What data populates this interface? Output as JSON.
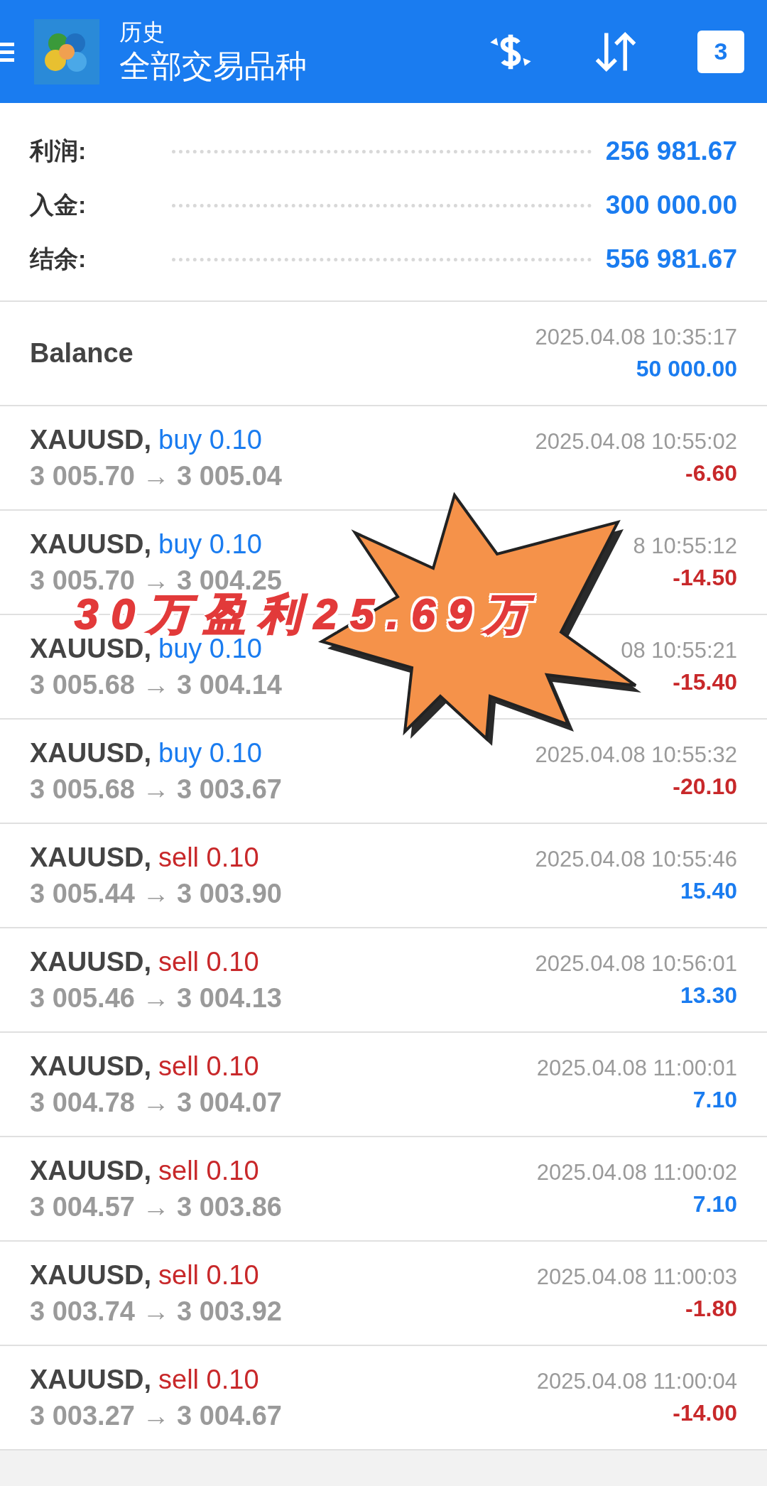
{
  "header": {
    "subtitle": "历史",
    "title": "全部交易品种",
    "calendar_day": "3"
  },
  "summary": [
    {
      "label": "利润:",
      "value": "256 981.67"
    },
    {
      "label": "入金:",
      "value": "300 000.00"
    },
    {
      "label": "结余:",
      "value": "556 981.67"
    }
  ],
  "balance": {
    "label": "Balance",
    "time": "2025.04.08 10:35:17",
    "amount": "50 000.00"
  },
  "trades": [
    {
      "symbol": "XAUUSD,",
      "kind": "buy",
      "side": "buy 0.10",
      "prices": "3 005.70 → 3 005.04",
      "time": "2025.04.08 10:55:02",
      "profit": "-6.60",
      "loss": true
    },
    {
      "symbol": "XAUUSD,",
      "kind": "buy",
      "side": "buy 0.10",
      "prices": "3 005.70 → 3 004.25",
      "time": "8 10:55:12",
      "profit": "-14.50",
      "loss": true
    },
    {
      "symbol": "XAUUSD,",
      "kind": "buy",
      "side": "buy 0.10",
      "prices": "3 005.68 → 3 004.14",
      "time": "08 10:55:21",
      "profit": "-15.40",
      "loss": true
    },
    {
      "symbol": "XAUUSD,",
      "kind": "buy",
      "side": "buy 0.10",
      "prices": "3 005.68 → 3 003.67",
      "time": "2025.04.08 10:55:32",
      "profit": "-20.10",
      "loss": true
    },
    {
      "symbol": "XAUUSD,",
      "kind": "sell",
      "side": "sell 0.10",
      "prices": "3 005.44 → 3 003.90",
      "time": "2025.04.08 10:55:46",
      "profit": "15.40",
      "loss": false
    },
    {
      "symbol": "XAUUSD,",
      "kind": "sell",
      "side": "sell 0.10",
      "prices": "3 005.46 → 3 004.13",
      "time": "2025.04.08 10:56:01",
      "profit": "13.30",
      "loss": false
    },
    {
      "symbol": "XAUUSD,",
      "kind": "sell",
      "side": "sell 0.10",
      "prices": "3 004.78 → 3 004.07",
      "time": "2025.04.08 11:00:01",
      "profit": "7.10",
      "loss": false
    },
    {
      "symbol": "XAUUSD,",
      "kind": "sell",
      "side": "sell 0.10",
      "prices": "3 004.57 → 3 003.86",
      "time": "2025.04.08 11:00:02",
      "profit": "7.10",
      "loss": false
    },
    {
      "symbol": "XAUUSD,",
      "kind": "sell",
      "side": "sell 0.10",
      "prices": "3 003.74 → 3 003.92",
      "time": "2025.04.08 11:00:03",
      "profit": "-1.80",
      "loss": true
    },
    {
      "symbol": "XAUUSD,",
      "kind": "sell",
      "side": "sell 0.10",
      "prices": "3 003.27 → 3 004.67",
      "time": "2025.04.08 11:00:04",
      "profit": "-14.00",
      "loss": true
    }
  ],
  "sticker": {
    "text": "30万盈利25.69万"
  }
}
